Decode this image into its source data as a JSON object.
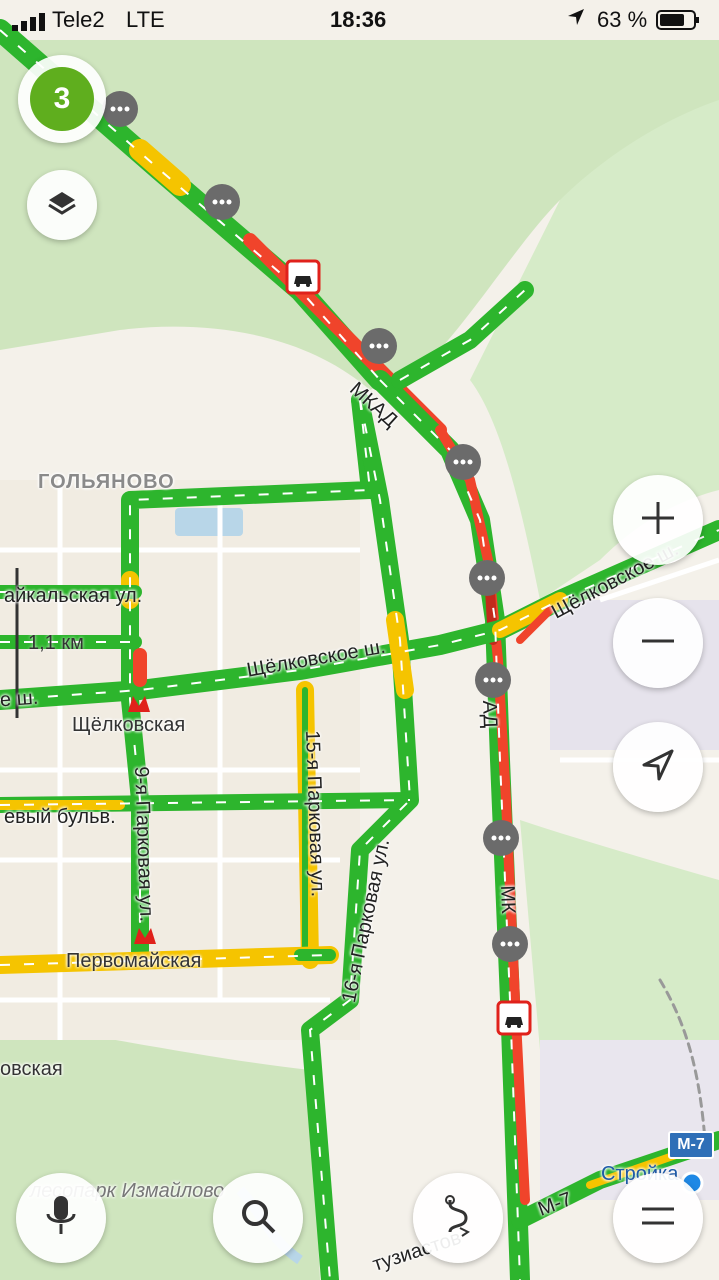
{
  "status_bar": {
    "carrier": "Tele2",
    "network": "LTE",
    "time": "18:36",
    "battery_percent": "63 %",
    "icons": [
      "signal-bars-icon",
      "location-arrow-icon",
      "battery-icon"
    ]
  },
  "traffic": {
    "score": "3",
    "color": "#5fae1e"
  },
  "colors": {
    "traffic_green": "#2db52d",
    "traffic_yellow": "#f5c400",
    "traffic_red": "#f0442b",
    "traffic_dark_red": "#c22a1c",
    "park_green": "#d4e8c4",
    "land": "#f4f1ea",
    "water": "#b8d6e8",
    "metro": "#e0211b"
  },
  "map_labels": {
    "district_golyanovo": "ГОЛЬЯНОВО",
    "mkad_north": "МКАД",
    "mkad_mid": "АД",
    "mkad_south": "МК",
    "schelkovskoe_w_left": "е ш.",
    "schelkovskoe_w_center": "Щёлковское ш.",
    "schelkovskoe_w_right": "Щёлковское ш.",
    "baikalskaya": "айкальская ул.",
    "metro_schelkovskaya": "Щёлковская",
    "metro_pervomayskaya": "Первомайская",
    "park_9": "9-я Парковая ул.",
    "park_15": "15-я Парковая ул.",
    "park_16": "16-я Парковая ул.",
    "boulevard": "евый бульв.",
    "ovskaya": "овская",
    "forest_park": "лесопарк Измайлово",
    "entuziastov": "тузиастов",
    "m7_road": "М-7",
    "m7_shield": "М-7",
    "stroyka": "Стройка"
  },
  "scale": {
    "label": "1,1 км"
  },
  "icons": {
    "layers": "layers-icon",
    "zoom_in": "plus-icon",
    "zoom_out": "minus-icon",
    "locate": "navigation-arrow-icon",
    "voice": "microphone-icon",
    "search": "search-icon",
    "routes": "route-icon",
    "menu": "menu-icon",
    "chat": "chat-bubble-icon",
    "accident": "accident-icon",
    "metro": "metro-m-icon"
  }
}
